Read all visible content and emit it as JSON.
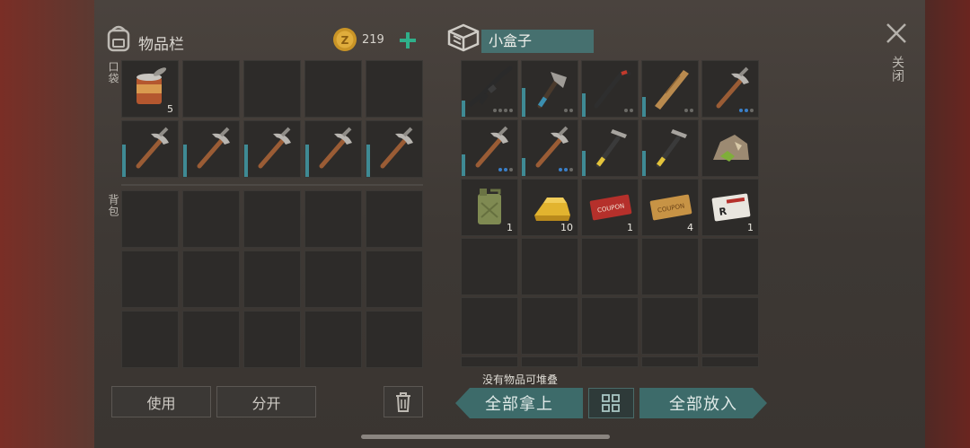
{
  "inventory": {
    "title": "物品栏",
    "coins": "219",
    "pocket_label": "口袋",
    "backpack_label": "背包",
    "pocket_slots": [
      {
        "icon": "tin-can-icon",
        "count": "5"
      },
      {
        "icon": "empty"
      },
      {
        "icon": "empty"
      },
      {
        "icon": "empty"
      },
      {
        "icon": "empty"
      },
      {
        "icon": "pickaxe-icon"
      },
      {
        "icon": "pickaxe-icon"
      },
      {
        "icon": "pickaxe-icon"
      },
      {
        "icon": "pickaxe-icon"
      },
      {
        "icon": "pickaxe-icon"
      }
    ],
    "backpack_rows": 3,
    "use_label": "使用",
    "split_label": "分开"
  },
  "container": {
    "name": "小盒子",
    "slots": [
      {
        "icon": "rifle-icon"
      },
      {
        "icon": "hatchet-icon"
      },
      {
        "icon": "crowbar-icon"
      },
      {
        "icon": "wooden-plank-icon"
      },
      {
        "icon": "pickaxe-icon"
      },
      {
        "icon": "pickaxe-icon"
      },
      {
        "icon": "pickaxe-icon"
      },
      {
        "icon": "hammer-icon"
      },
      {
        "icon": "hammer-icon"
      },
      {
        "icon": "ore-rock-icon"
      },
      {
        "icon": "jerrycan-icon",
        "count": "1"
      },
      {
        "icon": "gold-bar-icon",
        "count": "10"
      },
      {
        "icon": "coupon-red-icon",
        "count": "1"
      },
      {
        "icon": "coupon-gold-icon",
        "count": "4"
      },
      {
        "icon": "army-ticket-icon",
        "count": "1"
      }
    ],
    "no_stack_msg": "没有物品可堆叠",
    "take_all_label": "全部拿上",
    "put_all_label": "全部放入"
  },
  "close_label": "关闭",
  "colors": {
    "accent_teal": "#3d6b6a",
    "dur_bar": "#3f8a94",
    "plus_green": "#2fb08a"
  }
}
